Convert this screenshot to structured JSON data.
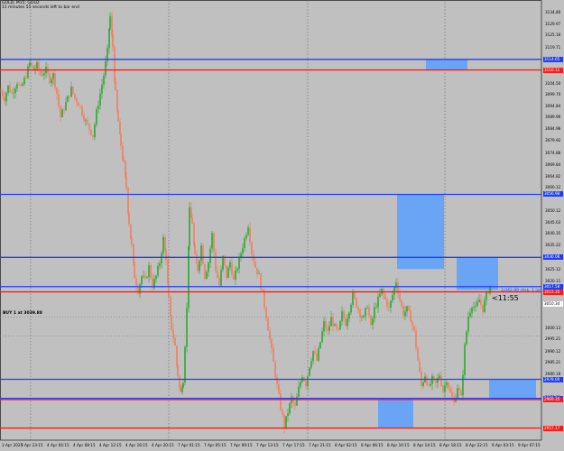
{
  "header": {
    "symbol_line": "GOLD, M15: GOLD",
    "countdown_line": "11 minutes 55 seconds left to bar end"
  },
  "order_label": "BUY 1 at 3039.88",
  "bid_line_label": "3,042.99 (Ask, 1 lot), 11:55",
  "countdown": "<11:55",
  "price_axis": {
    "labels": [
      {
        "text": "3134.80",
        "p": 3134.8
      },
      {
        "text": "3129.97",
        "p": 3129.97
      },
      {
        "text": "3125.16",
        "p": 3125.16
      },
      {
        "text": "3119.71",
        "p": 3119.71
      },
      {
        "text": "3104.50",
        "p": 3104.5
      },
      {
        "text": "3099.70",
        "p": 3099.7
      },
      {
        "text": "3094.84",
        "p": 3094.84
      },
      {
        "text": "3089.96",
        "p": 3089.96
      },
      {
        "text": "3084.98",
        "p": 3084.98
      },
      {
        "text": "3079.92",
        "p": 3079.92
      },
      {
        "text": "3074.88",
        "p": 3074.88
      },
      {
        "text": "3069.84",
        "p": 3069.84
      },
      {
        "text": "3064.82",
        "p": 3064.82
      },
      {
        "text": "3060.12",
        "p": 3060.12
      },
      {
        "text": "3050.12",
        "p": 3050.12
      },
      {
        "text": "3045.03",
        "p": 3045.03
      },
      {
        "text": "3040.35",
        "p": 3040.35
      },
      {
        "text": "3035.22",
        "p": 3035.22
      },
      {
        "text": "3030.07",
        "p": 3030.07
      },
      {
        "text": "3025.12",
        "p": 3025.12
      },
      {
        "text": "3020.11",
        "p": 3020.11
      },
      {
        "text": "3015.26",
        "p": 3015.26
      },
      {
        "text": "3010.12",
        "p": 3010.12
      },
      {
        "text": "3000.13",
        "p": 3000.13
      },
      {
        "text": "2995.21",
        "p": 2995.21
      },
      {
        "text": "2990.12",
        "p": 2990.12
      },
      {
        "text": "2985.21",
        "p": 2985.21
      },
      {
        "text": "2980.18",
        "p": 2980.18
      },
      {
        "text": "2970.21",
        "p": 2970.21
      }
    ]
  },
  "time_axis": {
    "labels": [
      "3 Apr 2025",
      "3 Apr 23:15",
      "4 Apr 04:15",
      "4 Apr 08:15",
      "4 Apr 12:15",
      "4 Apr 16:15",
      "4 Apr 20:15",
      "7 Apr 01:15",
      "7 Apr 05:15",
      "7 Apr 09:15",
      "7 Apr 13:15",
      "7 Apr 17:15",
      "7 Apr 21:15",
      "8 Apr 02:15",
      "8 Apr 06:15",
      "8 Apr 10:15",
      "8 Apr 14:15",
      "8 Apr 18:15",
      "8 Apr 22:15",
      "9 Apr 03:15",
      "9 Apr 07:15"
    ]
  },
  "levels": {
    "blue": [
      {
        "p": 3114.65,
        "tag": "3114.65"
      },
      {
        "p": 3056.98,
        "tag": "3056.98"
      },
      {
        "p": 3030.08,
        "tag": "3030.08"
      },
      {
        "p": 3017.58,
        "tag": "3017.58"
      },
      {
        "p": 2978.0,
        "tag": "2978.00"
      },
      {
        "p": 2969.84,
        "tag": "2969.84"
      }
    ],
    "red": [
      {
        "p": 3110.11,
        "tag": "3110.11"
      },
      {
        "p": 3015.35,
        "tag": "3015.35"
      },
      {
        "p": 2969.35,
        "tag": "2969.35"
      },
      {
        "p": 2957.17,
        "tag": "2957.17"
      }
    ],
    "white_tag": {
      "p": 3010.34,
      "tag": "3010.34"
    }
  },
  "colors": {
    "background": "#c0c0c0",
    "bull_candle": "#00a000",
    "bear_candle": "#ff6a3d",
    "blue_level": "#1f3fff",
    "red_level": "#ff1a1a",
    "zone": "#6aa5f5"
  },
  "chart_data": {
    "type": "candlestick",
    "instrument": "GOLD",
    "timeframe": "M15",
    "ylim": [
      2952,
      3140
    ],
    "price_path": [
      [
        0,
        3101
      ],
      [
        4,
        3098
      ],
      [
        8,
        3103
      ],
      [
        12,
        3100
      ],
      [
        18,
        3105
      ],
      [
        22,
        3102
      ],
      [
        28,
        3108
      ],
      [
        32,
        3113
      ],
      [
        36,
        3110
      ],
      [
        40,
        3112
      ],
      [
        44,
        3108
      ],
      [
        50,
        3110
      ],
      [
        54,
        3106
      ],
      [
        58,
        3108
      ],
      [
        62,
        3100
      ],
      [
        66,
        3090
      ],
      [
        70,
        3094
      ],
      [
        74,
        3098
      ],
      [
        78,
        3102
      ],
      [
        82,
        3098
      ],
      [
        86,
        3096
      ],
      [
        90,
        3092
      ],
      [
        94,
        3088
      ],
      [
        98,
        3085
      ],
      [
        102,
        3082
      ],
      [
        106,
        3092
      ],
      [
        110,
        3100
      ],
      [
        114,
        3108
      ],
      [
        118,
        3118
      ],
      [
        121,
        3133
      ],
      [
        124,
        3120
      ],
      [
        127,
        3100
      ],
      [
        130,
        3088
      ],
      [
        133,
        3078
      ],
      [
        136,
        3070
      ],
      [
        139,
        3060
      ],
      [
        142,
        3045
      ],
      [
        145,
        3035
      ],
      [
        148,
        3022
      ],
      [
        152,
        3016
      ],
      [
        156,
        3022
      ],
      [
        160,
        3020
      ],
      [
        164,
        3026
      ],
      [
        168,
        3018
      ],
      [
        172,
        3022
      ],
      [
        176,
        3028
      ],
      [
        180,
        3038
      ],
      [
        183,
        3030
      ],
      [
        186,
        3012
      ],
      [
        189,
        3000
      ],
      [
        193,
        2992
      ],
      [
        196,
        2980
      ],
      [
        199,
        2972
      ],
      [
        202,
        2978
      ],
      [
        206,
        3008
      ],
      [
        209,
        3050
      ],
      [
        212,
        3045
      ],
      [
        215,
        3030
      ],
      [
        218,
        3025
      ],
      [
        222,
        3035
      ],
      [
        226,
        3022
      ],
      [
        230,
        3028
      ],
      [
        234,
        3040
      ],
      [
        238,
        3025
      ],
      [
        242,
        3018
      ],
      [
        246,
        3030
      ],
      [
        250,
        3022
      ],
      [
        254,
        3028
      ],
      [
        258,
        3020
      ],
      [
        262,
        3026
      ],
      [
        266,
        3032
      ],
      [
        270,
        3038
      ],
      [
        274,
        3044
      ],
      [
        278,
        3032
      ],
      [
        282,
        3026
      ],
      [
        286,
        3022
      ],
      [
        290,
        3014
      ],
      [
        294,
        3005
      ],
      [
        298,
        2995
      ],
      [
        302,
        2985
      ],
      [
        306,
        2975
      ],
      [
        310,
        2966
      ],
      [
        314,
        2958
      ],
      [
        318,
        2964
      ],
      [
        322,
        2970
      ],
      [
        326,
        2966
      ],
      [
        330,
        2974
      ],
      [
        334,
        2980
      ],
      [
        338,
        2976
      ],
      [
        342,
        2984
      ],
      [
        346,
        2990
      ],
      [
        350,
        2986
      ],
      [
        354,
        2994
      ],
      [
        358,
        3002
      ],
      [
        362,
        2998
      ],
      [
        366,
        3004
      ],
      [
        370,
        3000
      ],
      [
        374,
        2998
      ],
      [
        378,
        3006
      ],
      [
        382,
        3002
      ],
      [
        386,
        3008
      ],
      [
        390,
        3014
      ],
      [
        394,
        3010
      ],
      [
        398,
        3006
      ],
      [
        402,
        3004
      ],
      [
        406,
        3010
      ],
      [
        410,
        3000
      ],
      [
        414,
        3008
      ],
      [
        418,
        3012
      ],
      [
        422,
        3016
      ],
      [
        426,
        3012
      ],
      [
        430,
        3008
      ],
      [
        434,
        3014
      ],
      [
        438,
        3020
      ],
      [
        442,
        3012
      ],
      [
        446,
        3006
      ],
      [
        450,
        3008
      ],
      [
        454,
        3004
      ],
      [
        458,
        2998
      ],
      [
        462,
        2986
      ],
      [
        466,
        2975
      ],
      [
        470,
        2980
      ],
      [
        474,
        2974
      ],
      [
        478,
        2978
      ],
      [
        482,
        2976
      ],
      [
        486,
        2980
      ],
      [
        490,
        2973
      ],
      [
        494,
        2978
      ],
      [
        498,
        2972
      ],
      [
        502,
        2968
      ],
      [
        506,
        2975
      ],
      [
        510,
        2970
      ],
      [
        514,
        2992
      ],
      [
        518,
        3005
      ],
      [
        522,
        3010
      ],
      [
        526,
        3008
      ],
      [
        530,
        3012
      ],
      [
        534,
        3008
      ],
      [
        538,
        3014
      ],
      [
        542,
        3018
      ],
      [
        546,
        3016
      ]
    ]
  }
}
